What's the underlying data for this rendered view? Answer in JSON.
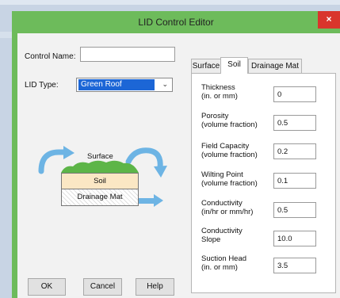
{
  "window": {
    "title": "LID Control Editor",
    "close_glyph": "×"
  },
  "form": {
    "control_name_label": "Control Name:",
    "control_name_value": "",
    "lid_type_label": "LID Type:",
    "lid_type_value": "Green Roof"
  },
  "diagram": {
    "surface_label": "Surface",
    "soil_label": "Soil",
    "drainage_label": "Drainage Mat",
    "colors": {
      "grass": "#5db548",
      "soil": "#fbe7c4",
      "arrows": "#6db4e4"
    }
  },
  "buttons": {
    "ok": "OK",
    "cancel": "Cancel",
    "help": "Help"
  },
  "tabs": [
    {
      "label": "Surface",
      "active": false
    },
    {
      "label": "Soil",
      "active": true
    },
    {
      "label": "Drainage Mat",
      "active": false
    }
  ],
  "soil_params": [
    {
      "label_line1": "Thickness",
      "label_line2": "(in. or mm)",
      "value": "0"
    },
    {
      "label_line1": "Porosity",
      "label_line2": "(volume fraction)",
      "value": "0.5"
    },
    {
      "label_line1": "Field Capacity",
      "label_line2": "(volume fraction)",
      "value": "0.2"
    },
    {
      "label_line1": "Wilting Point",
      "label_line2": "(volume fraction)",
      "value": "0.1"
    },
    {
      "label_line1": "Conductivity",
      "label_line2": "(in/hr or mm/hr)",
      "value": "0.5"
    },
    {
      "label_line1": "Conductivity",
      "label_line2": "Slope",
      "value": "10.0"
    },
    {
      "label_line1": "Suction Head",
      "label_line2": "(in. or mm)",
      "value": "3.5"
    }
  ]
}
